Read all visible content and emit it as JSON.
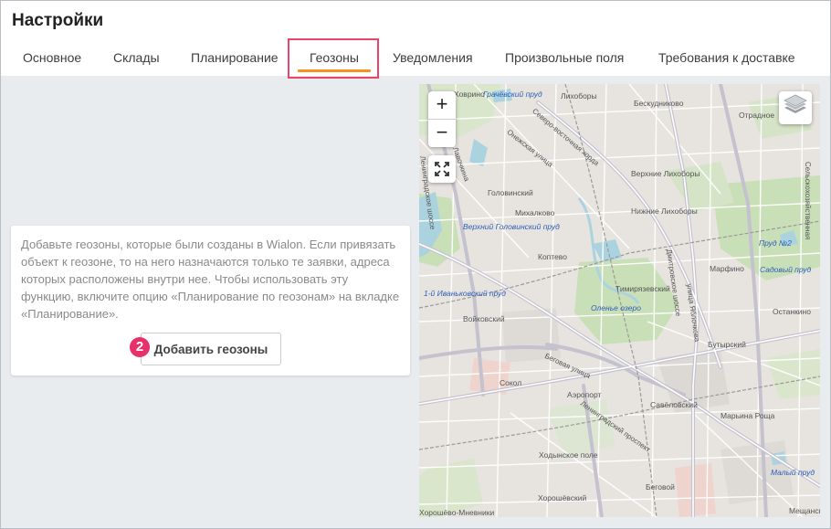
{
  "page": {
    "title": "Настройки"
  },
  "tabs": [
    {
      "label": "Основное"
    },
    {
      "label": "Склады"
    },
    {
      "label": "Планирование"
    },
    {
      "label": "Геозоны",
      "active": true
    },
    {
      "label": "Уведомления"
    },
    {
      "label": "Произвольные поля"
    },
    {
      "label": "Требования к доставке"
    }
  ],
  "card": {
    "text": "Добавьте геозоны, которые были созданы в Wialon. Если привязать объект к геозоне, то на него назначаются только те заявки, адреса которых расположены внутри нее. Чтобы использовать эту функцию, включите опцию «Планирование по геозонам» на вкладке «Планирование».",
    "button_label": "Добавить геозоны",
    "step_badge": "2"
  },
  "map": {
    "zoom_in": "+",
    "zoom_out": "−",
    "labels": [
      "Грачёвский пруд",
      "Ховрино",
      "Лихоборы",
      "Бескудниково",
      "Отрадное",
      "улица Лавочкина",
      "Северо-восточная хорда",
      "Онежская улица",
      "Головинский",
      "Верхние Лихоборы",
      "Нижние Лихоборы",
      "Ленинградское шоссе",
      "Верхний Головинский пруд",
      "Михалково",
      "Коптево",
      "Пруд №2",
      "Садовый пруд",
      "Марфино",
      "1-й Иваньковский пруд",
      "Дмитровское шоссе",
      "Тимирязевский",
      "Оленье озеро",
      "улица Яблочкова",
      "Войковский",
      "Останкино",
      "Бутырский",
      "Сельскохозяйственная",
      "Сокол",
      "Аэропорт",
      "Беговая улица",
      "Ленинградский проспект",
      "Савёловский",
      "Марьина Роща",
      "Ходынское поле",
      "Хорошёвский",
      "Беговой",
      "Малый пруд",
      "Хорошёво-Мневники",
      "Мещанский"
    ],
    "colors": {
      "land": "#e7e4df",
      "park": "#c9dfb7",
      "water": "#aad3df",
      "road": "#ffffff",
      "major_road": "#c4c2ce"
    }
  },
  "accent": {
    "tab_underline": "#f5911e",
    "highlight_box": "#e8456b",
    "badge": "#e8306a"
  }
}
